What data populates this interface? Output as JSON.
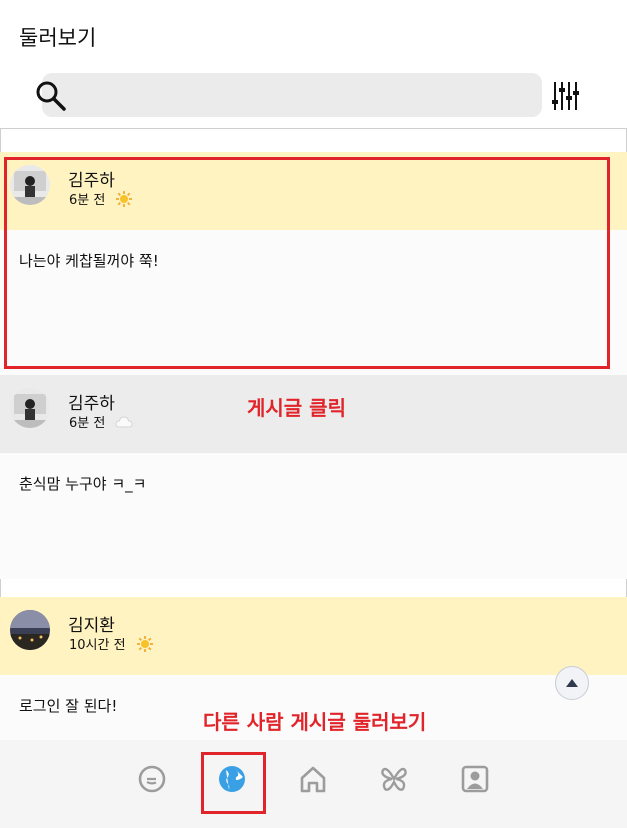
{
  "header": {
    "title": "둘러보기"
  },
  "search": {
    "placeholder": ""
  },
  "posts": [
    {
      "author": "김주하",
      "time": "6분 전",
      "weather": "sun-icon",
      "text": "나는야 케찹될꺼야 쭉!",
      "head_color": "#fff3c2"
    },
    {
      "author": "김주하",
      "time": "6분 전",
      "weather": "cloud-icon",
      "text": "춘식맘 누구야 ㅋ_ㅋ",
      "head_color": "#ececec"
    },
    {
      "author": "김지환",
      "time": "10시간 전",
      "weather": "sun-icon",
      "text": "로그인 잘 된다!",
      "head_color": "#fff3c2"
    }
  ],
  "annotations": {
    "post_click": "게시글 클릭",
    "browse_others": "다른 사람 게시글 둘러보기"
  },
  "nav": {
    "items": [
      "chat-bubble-icon",
      "globe-icon",
      "home-icon",
      "butterfly-icon",
      "profile-icon"
    ],
    "active": "globe-icon",
    "accent": "#3aa0e6"
  },
  "colors": {
    "annotation": "#e1242a"
  }
}
